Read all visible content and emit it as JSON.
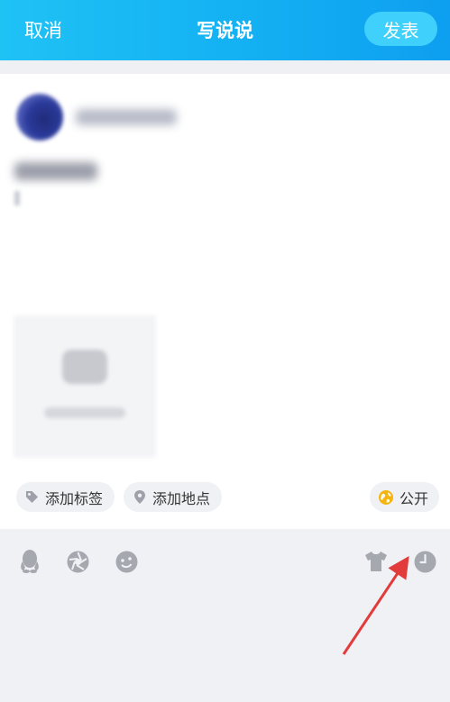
{
  "header": {
    "cancel_label": "取消",
    "title": "写说说",
    "publish_label": "发表"
  },
  "chips": {
    "add_tag_label": "添加标签",
    "add_location_label": "添加地点",
    "visibility_label": "公开"
  },
  "toolbar": {
    "icons": [
      "qq-penguin-icon",
      "camera-shutter-icon",
      "emoji-icon",
      "shirt-icon",
      "clock-icon"
    ]
  },
  "colors": {
    "header_start": "#1fc2f5",
    "header_end": "#0e9ff0",
    "publish_button": "#3fd0fb",
    "toolbar_bg": "#f0f1f5",
    "icon_gray": "#a6a8b0",
    "visibility_icon": "#f6b50e",
    "annotation_arrow": "#e23b3b"
  }
}
